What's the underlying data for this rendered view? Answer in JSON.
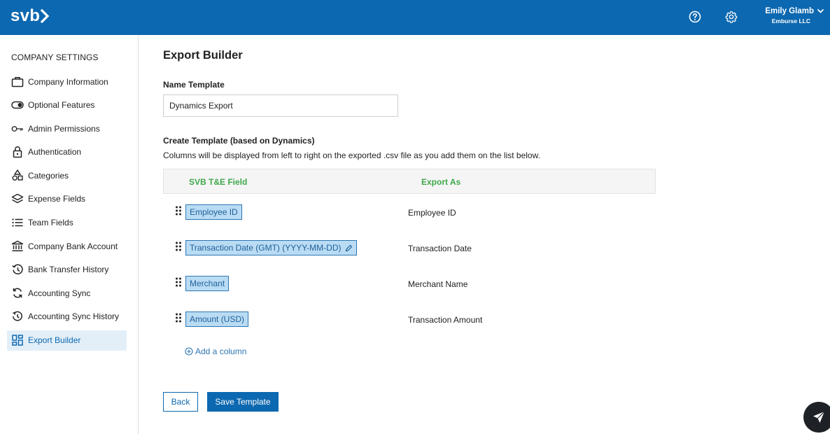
{
  "header": {
    "logo_text": "svb",
    "user_name": "Emily Glamb",
    "user_company": "Emburse LLC"
  },
  "sidebar": {
    "title": "COMPANY SETTINGS",
    "items": [
      {
        "label": "Company Information",
        "icon": "briefcase-icon"
      },
      {
        "label": "Optional Features",
        "icon": "toggle-icon"
      },
      {
        "label": "Admin Permissions",
        "icon": "key-icon"
      },
      {
        "label": "Authentication",
        "icon": "lock-icon"
      },
      {
        "label": "Categories",
        "icon": "shapes-icon"
      },
      {
        "label": "Expense Fields",
        "icon": "layers-icon"
      },
      {
        "label": "Team Fields",
        "icon": "list-icon"
      },
      {
        "label": "Company Bank Account",
        "icon": "bank-icon"
      },
      {
        "label": "Bank Transfer History",
        "icon": "history-icon"
      },
      {
        "label": "Accounting Sync",
        "icon": "sync-icon"
      },
      {
        "label": "Accounting Sync History",
        "icon": "sync-history-icon"
      },
      {
        "label": "Export Builder",
        "icon": "grid-icon",
        "active": true
      }
    ]
  },
  "main": {
    "page_title": "Export Builder",
    "name_label": "Name Template",
    "name_value": "Dynamics Export",
    "create_label": "Create Template (based on Dynamics)",
    "description": "Columns will be displayed from left to right on the exported .csv file as you add them on the list below.",
    "columns_header": {
      "field": "SVB T&E Field",
      "export_as": "Export As"
    },
    "rows": [
      {
        "field": "Employee ID",
        "export_as": "Employee ID",
        "editable": false
      },
      {
        "field": "Transaction Date (GMT) (YYYY-MM-DD)",
        "export_as": "Transaction Date",
        "editable": true
      },
      {
        "field": "Merchant",
        "export_as": "Merchant Name",
        "editable": false
      },
      {
        "field": "Amount (USD)",
        "export_as": "Transaction Amount",
        "editable": false
      }
    ],
    "add_column_label": "Add a column",
    "back_label": "Back",
    "save_label": "Save Template"
  },
  "colors": {
    "brand": "#0c68b0",
    "header_text": "#3fa84a",
    "chip_bg": "#b9dcf4",
    "active_nav_bg": "#e3eff8"
  }
}
